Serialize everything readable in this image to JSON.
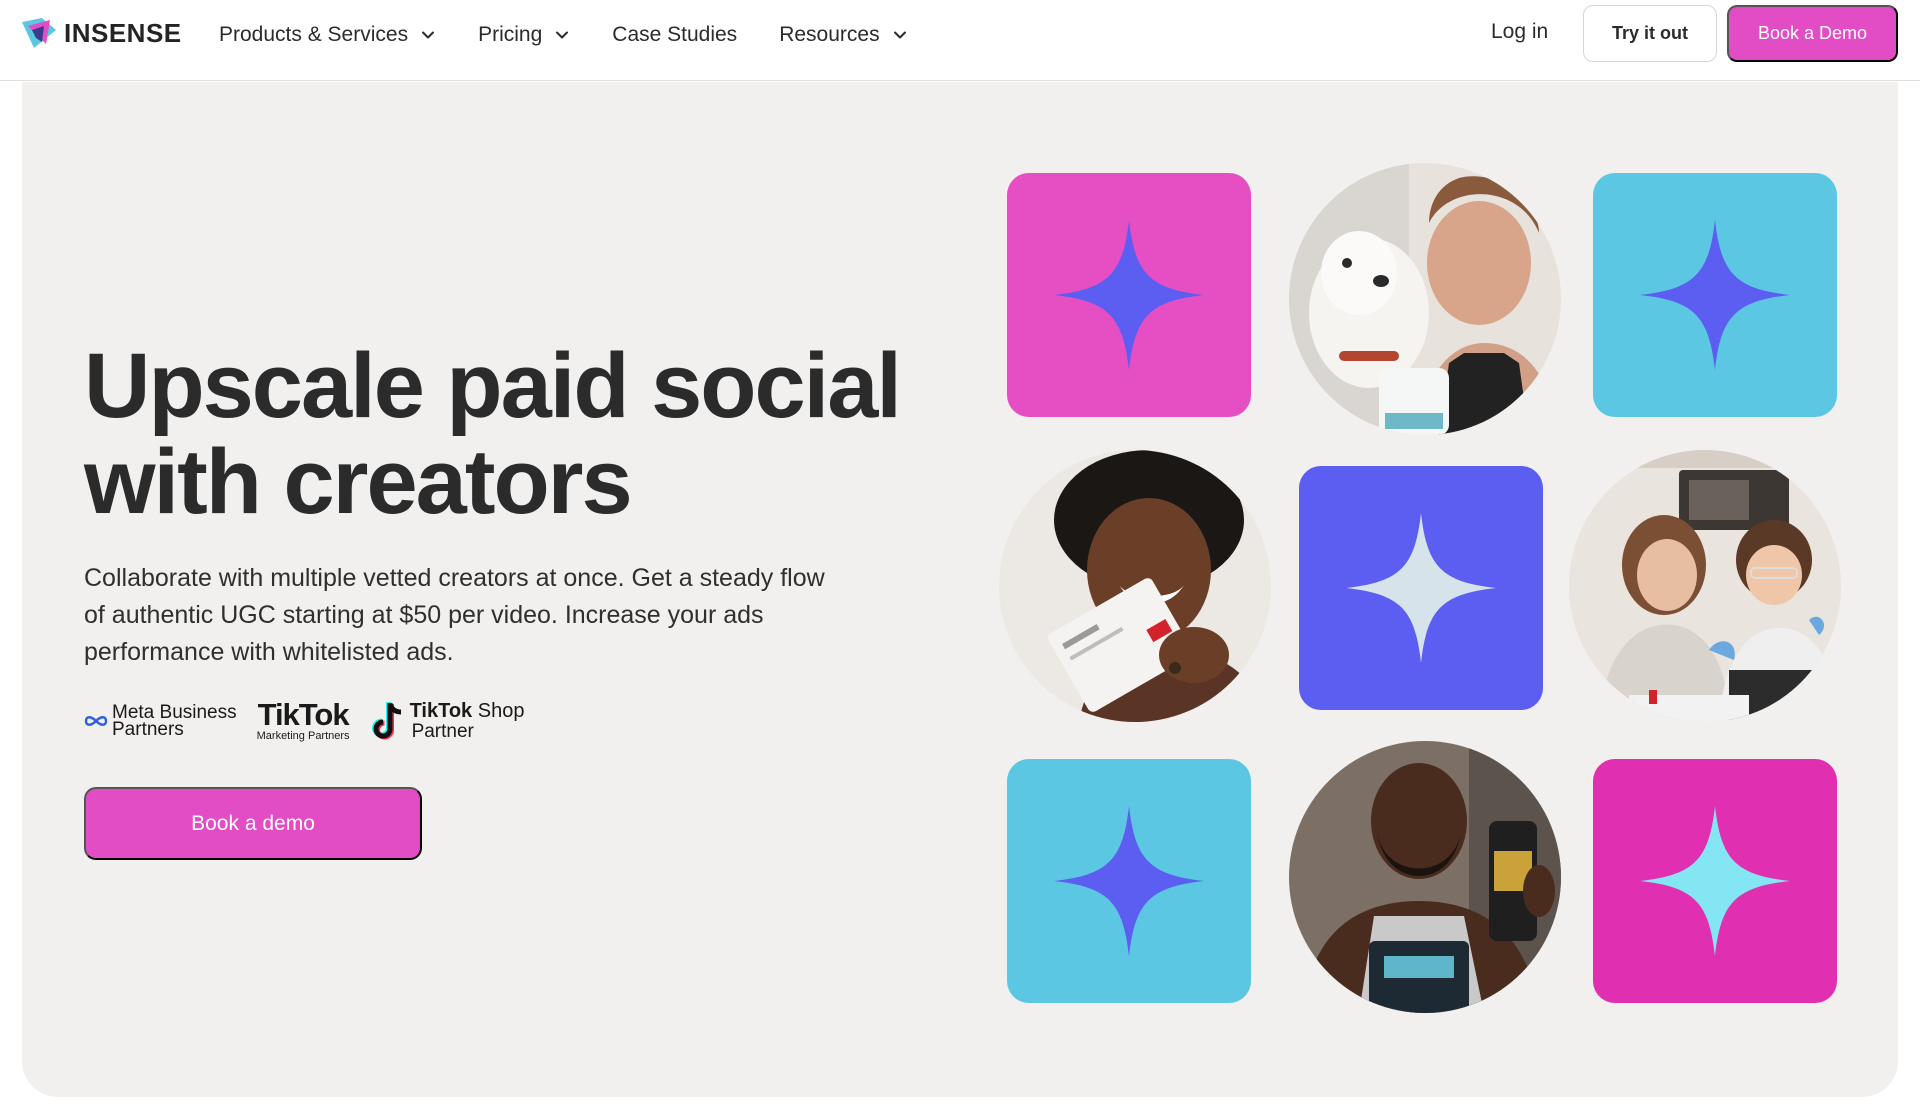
{
  "brand": {
    "name": "INSENSE",
    "accent": "#e24dc5",
    "hero_bg": "#f1f0ee"
  },
  "nav": {
    "items": [
      {
        "label": "Products & Services",
        "has_dropdown": true
      },
      {
        "label": "Pricing",
        "has_dropdown": true
      },
      {
        "label": "Case Studies",
        "has_dropdown": false
      },
      {
        "label": "Resources",
        "has_dropdown": true
      }
    ],
    "login": "Log in",
    "try_label": "Try it out",
    "demo_label": "Book a Demo"
  },
  "hero": {
    "headline_line1": "Upscale paid social",
    "headline_line2": "with creators",
    "subtext": "Collaborate with multiple vetted creators at once. Get a steady flow of authentic UGC starting at $50 per video. Increase your ads performance with whitelisted ads.",
    "cta_label": "Book a demo"
  },
  "partners": {
    "meta_line1": "Meta Business",
    "meta_line2": "Partners",
    "tiktok_big": "TikTok",
    "tiktok_small": "Marketing Partners",
    "shop_bold": "TikTok",
    "shop_rest": "Shop",
    "shop_line2": "Partner"
  },
  "tiles": {
    "colors": {
      "pink": "#e54fc3",
      "cyan": "#5bc7e2",
      "indigo": "#5b5ef0",
      "magenta": "#e02fb0",
      "sparkle_indigo": "#5b5ef0",
      "sparkle_pale": "#d6e3ea",
      "sparkle_light_cyan": "#84e6f2"
    }
  }
}
